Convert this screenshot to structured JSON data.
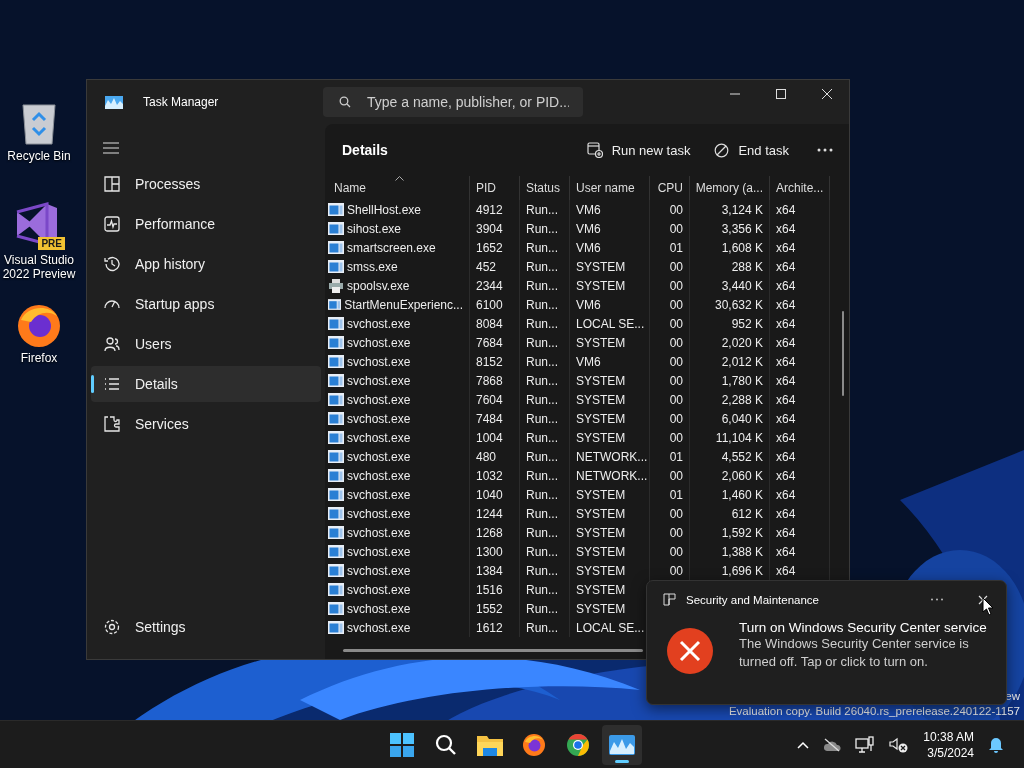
{
  "desktop_icons": [
    {
      "label": "Recycle Bin",
      "kind": "bin"
    },
    {
      "label": "Visual Studio 2022 Preview",
      "kind": "ide",
      "badge": "PRE"
    },
    {
      "label": "Firefox",
      "kind": "browser"
    }
  ],
  "window": {
    "title": "Task Manager",
    "search": {
      "placeholder": "Type a name, publisher, or PID..."
    }
  },
  "sidebar": {
    "items": [
      {
        "label": "Processes",
        "kind": "processes",
        "selected": false
      },
      {
        "label": "Performance",
        "kind": "performance",
        "selected": false
      },
      {
        "label": "App history",
        "kind": "history",
        "selected": false
      },
      {
        "label": "Startup apps",
        "kind": "startup",
        "selected": false
      },
      {
        "label": "Users",
        "kind": "users",
        "selected": false
      },
      {
        "label": "Details",
        "kind": "details",
        "selected": true
      },
      {
        "label": "Services",
        "kind": "services",
        "selected": false
      }
    ],
    "settings": "Settings"
  },
  "page": {
    "title": "Details",
    "actions": [
      {
        "label": "Run new task",
        "kind": "run"
      },
      {
        "label": "End task",
        "kind": "end"
      }
    ]
  },
  "table": {
    "columns": [
      {
        "label": "Name",
        "sorted": true,
        "kind": "text"
      },
      {
        "label": "PID",
        "sorted": false,
        "kind": "text"
      },
      {
        "label": "Status",
        "sorted": false,
        "kind": "text"
      },
      {
        "label": "User name",
        "sorted": false,
        "kind": "text"
      },
      {
        "label": "CPU",
        "sorted": false,
        "kind": "number"
      },
      {
        "label": "Memory (a...",
        "sorted": false,
        "kind": "number"
      },
      {
        "label": "Archite...",
        "sorted": false,
        "kind": "text"
      }
    ],
    "rows": [
      {
        "kind": "app",
        "cells": [
          "ShellHost.exe",
          "4912",
          "Run...",
          "VM6",
          "00",
          "3,124 K",
          "x64"
        ]
      },
      {
        "kind": "app",
        "cells": [
          "sihost.exe",
          "3904",
          "Run...",
          "VM6",
          "00",
          "3,356 K",
          "x64"
        ]
      },
      {
        "kind": "app",
        "cells": [
          "smartscreen.exe",
          "1652",
          "Run...",
          "VM6",
          "01",
          "1,608 K",
          "x64"
        ]
      },
      {
        "kind": "app",
        "cells": [
          "smss.exe",
          "452",
          "Run...",
          "SYSTEM",
          "00",
          "288 K",
          "x64"
        ]
      },
      {
        "kind": "printer",
        "cells": [
          "spoolsv.exe",
          "2344",
          "Run...",
          "SYSTEM",
          "00",
          "3,440 K",
          "x64"
        ]
      },
      {
        "kind": "app",
        "cells": [
          "StartMenuExperienc...",
          "6100",
          "Run...",
          "VM6",
          "00",
          "30,632 K",
          "x64"
        ]
      },
      {
        "kind": "app",
        "cells": [
          "svchost.exe",
          "8084",
          "Run...",
          "LOCAL SE...",
          "00",
          "952 K",
          "x64"
        ]
      },
      {
        "kind": "app",
        "cells": [
          "svchost.exe",
          "7684",
          "Run...",
          "SYSTEM",
          "00",
          "2,020 K",
          "x64"
        ]
      },
      {
        "kind": "app",
        "cells": [
          "svchost.exe",
          "8152",
          "Run...",
          "VM6",
          "00",
          "2,012 K",
          "x64"
        ]
      },
      {
        "kind": "app",
        "cells": [
          "svchost.exe",
          "7868",
          "Run...",
          "SYSTEM",
          "00",
          "1,780 K",
          "x64"
        ]
      },
      {
        "kind": "app",
        "cells": [
          "svchost.exe",
          "7604",
          "Run...",
          "SYSTEM",
          "00",
          "2,288 K",
          "x64"
        ]
      },
      {
        "kind": "app",
        "cells": [
          "svchost.exe",
          "7484",
          "Run...",
          "SYSTEM",
          "00",
          "6,040 K",
          "x64"
        ]
      },
      {
        "kind": "app",
        "cells": [
          "svchost.exe",
          "1004",
          "Run...",
          "SYSTEM",
          "00",
          "11,104 K",
          "x64"
        ]
      },
      {
        "kind": "app",
        "cells": [
          "svchost.exe",
          "480",
          "Run...",
          "NETWORK...",
          "01",
          "4,552 K",
          "x64"
        ]
      },
      {
        "kind": "app",
        "cells": [
          "svchost.exe",
          "1032",
          "Run...",
          "NETWORK...",
          "00",
          "2,060 K",
          "x64"
        ]
      },
      {
        "kind": "app",
        "cells": [
          "svchost.exe",
          "1040",
          "Run...",
          "SYSTEM",
          "01",
          "1,460 K",
          "x64"
        ]
      },
      {
        "kind": "app",
        "cells": [
          "svchost.exe",
          "1244",
          "Run...",
          "SYSTEM",
          "00",
          "612 K",
          "x64"
        ]
      },
      {
        "kind": "app",
        "cells": [
          "svchost.exe",
          "1268",
          "Run...",
          "SYSTEM",
          "00",
          "1,592 K",
          "x64"
        ]
      },
      {
        "kind": "app",
        "cells": [
          "svchost.exe",
          "1300",
          "Run...",
          "SYSTEM",
          "00",
          "1,388 K",
          "x64"
        ]
      },
      {
        "kind": "app",
        "cells": [
          "svchost.exe",
          "1384",
          "Run...",
          "SYSTEM",
          "00",
          "1,696 K",
          "x64"
        ]
      },
      {
        "kind": "app",
        "cells": [
          "svchost.exe",
          "1516",
          "Run...",
          "SYSTEM"
        ]
      },
      {
        "kind": "app",
        "cells": [
          "svchost.exe",
          "1552",
          "Run...",
          "SYSTEM"
        ]
      },
      {
        "kind": "app",
        "cells": [
          "svchost.exe",
          "1612",
          "Run...",
          "LOCAL SE..."
        ]
      }
    ]
  },
  "notification": {
    "app": "Security and Maintenance",
    "title": "Turn on Windows Security Center service",
    "body": "The Windows Security Center service is turned off. Tap or click to turn on."
  },
  "watermark": {
    "line_1": "ew",
    "line_2": "Evaluation copy. Build 26040.rs_prerelease.240122-1157"
  },
  "taskbar": {
    "apps": [
      {
        "kind": "start",
        "selected": false
      },
      {
        "kind": "search",
        "selected": false
      },
      {
        "kind": "folder",
        "selected": false
      },
      {
        "kind": "firefox",
        "selected": false
      },
      {
        "kind": "chrome",
        "selected": false
      },
      {
        "kind": "taskmanager",
        "selected": true
      }
    ],
    "time": "10:38 AM",
    "date": "3/5/2024"
  }
}
